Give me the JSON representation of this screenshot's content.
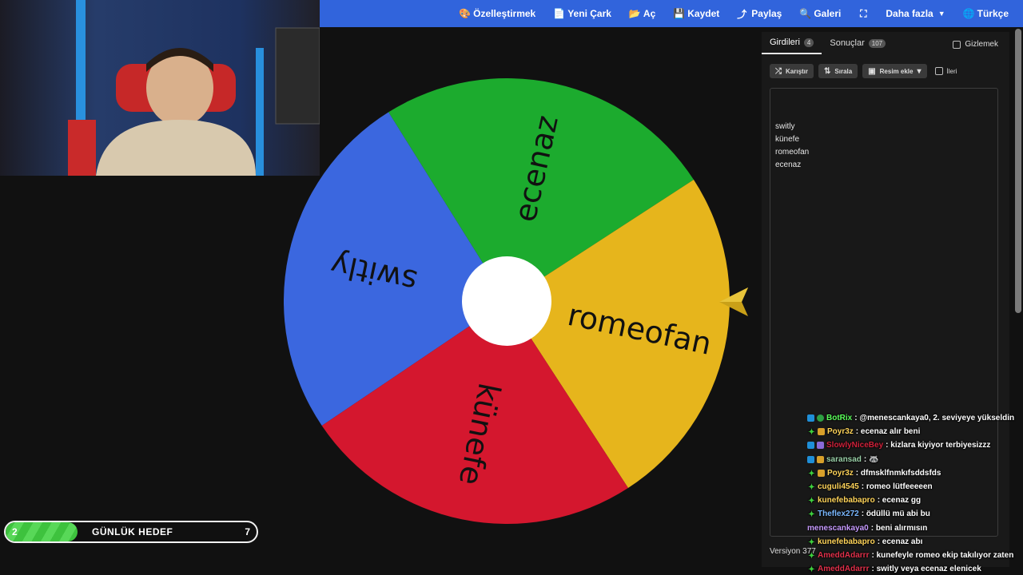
{
  "nav": {
    "items": [
      {
        "icon": "palette-icon",
        "glyph": "🎨",
        "label": "Özelleştirmek"
      },
      {
        "icon": "file-icon",
        "glyph": "📄",
        "label": "Yeni Çark"
      },
      {
        "icon": "folder-open-icon",
        "glyph": "📂",
        "label": "Aç"
      },
      {
        "icon": "save-icon",
        "glyph": "💾",
        "label": "Kaydet"
      },
      {
        "icon": "share-icon",
        "glyph": "⤴",
        "label": "Paylaş"
      },
      {
        "icon": "search-icon",
        "glyph": "🔍",
        "label": "Galeri"
      },
      {
        "icon": "fullscreen-icon",
        "glyph": "⛶",
        "label": ""
      },
      {
        "icon": "more-icon",
        "glyph": "",
        "label": "Daha fazla"
      },
      {
        "icon": "globe-icon",
        "glyph": "🌐",
        "label": "Türkçe"
      }
    ],
    "color": "#3164dc"
  },
  "panel": {
    "tabs": [
      {
        "label": "Girdileri",
        "count": "4"
      },
      {
        "label": "Sonuçlar",
        "count": "107"
      }
    ],
    "hide_label": "Gizlemek",
    "toolbar": {
      "shuffle": "Karıştır",
      "sort": "Sırala",
      "add_image": "Resim ekle",
      "advanced": "İleri"
    },
    "entries": [
      "switly",
      "künefe",
      "romeofan",
      "ecenaz"
    ],
    "version": "Versiyon 377"
  },
  "wheel": {
    "segments": [
      {
        "label": "switly",
        "color": "#3b67df"
      },
      {
        "label": "ecenaz",
        "color": "#1cab2e"
      },
      {
        "label": "romeofan",
        "color": "#e6b51c"
      },
      {
        "label": "künefe",
        "color": "#d4172e"
      }
    ]
  },
  "goal": {
    "current": "2",
    "label": "GÜNLÜK HEDEF",
    "target": "7",
    "progress_fraction": 0.2857
  },
  "chat": [
    {
      "user": "BotRix",
      "color": "#5bff5b",
      "badges": [
        "vip",
        "mod"
      ],
      "message": "@menescankaya0, 2. seviyeye yükseldin"
    },
    {
      "user": "Poyr3z",
      "color": "#ffd45a",
      "badges": [
        "star",
        "gift"
      ],
      "message": "ecenaz alır beni"
    },
    {
      "user": "SlowlyNiceBey",
      "color": "#d0213a",
      "badges": [
        "vip",
        "sub"
      ],
      "message": "kizlara kiyiyor terbiyesizzz"
    },
    {
      "user": "saransad",
      "color": "#9ad0a8",
      "badges": [
        "vip",
        "gift"
      ],
      "message": "🦝"
    },
    {
      "user": "Poyr3z",
      "color": "#ffd45a",
      "badges": [
        "star",
        "gift"
      ],
      "message": "dfmsklfnmkıfsddsfds"
    },
    {
      "user": "cuguli4545",
      "color": "#ffd45a",
      "badges": [
        "star"
      ],
      "message": "romeo lütfeeeeen"
    },
    {
      "user": "kunefebabapro",
      "color": "#ffd45a",
      "badges": [
        "star"
      ],
      "message": "ecenaz gg"
    },
    {
      "user": "Theflex272",
      "color": "#7ab8ff",
      "badges": [
        "star"
      ],
      "message": "ödüllü mü abi bu"
    },
    {
      "user": "menescankaya0",
      "color": "#c79bff",
      "badges": [],
      "message": "beni alırmısın"
    },
    {
      "user": "kunefebabapro",
      "color": "#ffd45a",
      "badges": [
        "star"
      ],
      "message": "ecenaz abı"
    },
    {
      "user": "AmeddAdarrr",
      "color": "#e0304a",
      "badges": [
        "star"
      ],
      "message": "kunefeyle romeo ekip takılıyor zaten"
    },
    {
      "user": "AmeddAdarrr",
      "color": "#e0304a",
      "badges": [
        "star"
      ],
      "message": "switly veya ecenaz elenicek"
    }
  ]
}
